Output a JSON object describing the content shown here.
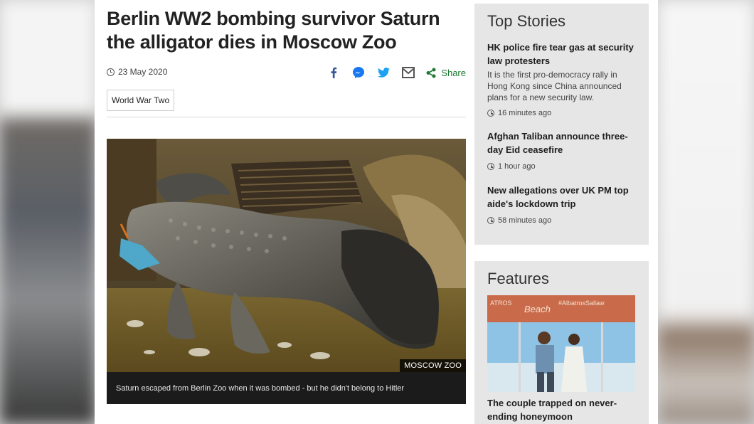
{
  "article": {
    "headline": "Berlin WW2 bombing survivor Saturn the alligator dies in Moscow Zoo",
    "date": "23 May 2020",
    "share_label": "Share",
    "share_icons": [
      "facebook-icon",
      "messenger-icon",
      "twitter-icon",
      "email-icon",
      "share-icon"
    ],
    "tag": "World War Two",
    "image_credit": "MOSCOW ZOO",
    "caption": "Saturn escaped from Berlin Zoo when it was bombed - but he didn't belong to Hitler"
  },
  "top_stories": {
    "title": "Top Stories",
    "items": [
      {
        "title": "HK police fire tear gas at security law protesters",
        "summary": "It is the first pro-democracy rally in Hong Kong since China announced plans for a new security law.",
        "time": "16 minutes ago"
      },
      {
        "title": "Afghan Taliban announce three-day Eid ceasefire",
        "time": "1 hour ago"
      },
      {
        "title": "New allegations over UK PM top aide's lockdown trip",
        "time": "58 minutes ago"
      }
    ]
  },
  "features": {
    "title": "Features",
    "image_sign_text": "ATROS Beach #AlbatrosSallaw",
    "item_title": "The couple trapped on never-ending honeymoon"
  },
  "colors": {
    "share_green": "#1e7a34",
    "facebook_blue": "#3b5998",
    "twitter_blue": "#1da1f2",
    "sidebar_bg": "#e6e6e6"
  }
}
